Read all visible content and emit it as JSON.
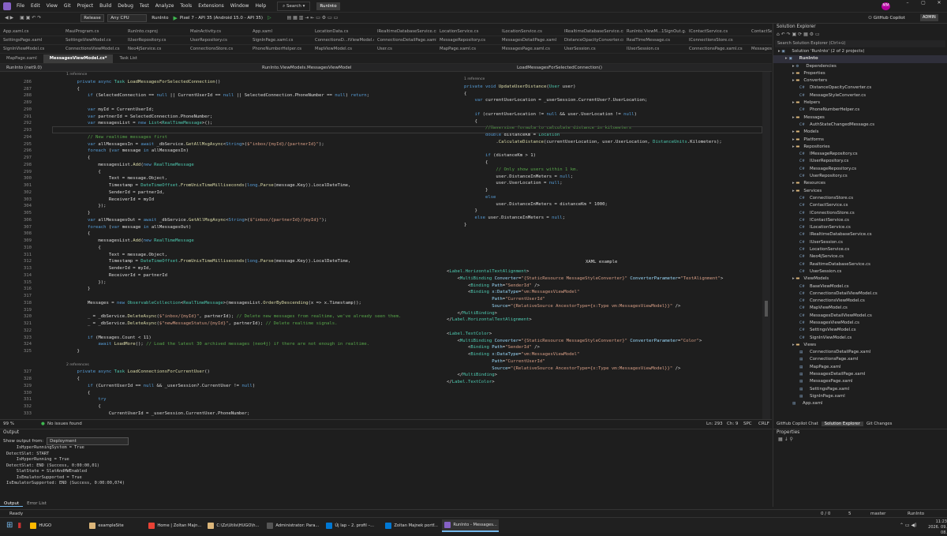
{
  "menu": [
    "File",
    "Edit",
    "View",
    "Git",
    "Project",
    "Build",
    "Debug",
    "Test",
    "Analyze",
    "Tools",
    "Extensions",
    "Window",
    "Help"
  ],
  "search_label": "Search",
  "app_badge": "RunInto",
  "user_initials": "MM",
  "window_controls": [
    "–",
    "▢",
    "✕"
  ],
  "toolbar": {
    "config": "Release",
    "platform": "Any CPU",
    "startup": "RunInto",
    "device": "Pixel 7 - API 35 (Android 15.0 - API 35)",
    "copilot": "GitHub Copilot",
    "admin": "ADMIN"
  },
  "tabs_row1": [
    "App.xaml.cs",
    "MauiProgram.cs",
    "RunInto.csproj",
    "MainActivity.cs",
    "App.xaml",
    "LocationData.cs",
    "IRealtimeDatabaseService.cs",
    "LocationService.cs",
    "ILocationService.cs",
    "IRealtimeDatabaseService.cs",
    "RunInto.ViewM...1SignOut.g.cs",
    "IContactService.cs",
    "ContactService.cs"
  ],
  "tabs_row2": [
    "SettingsPage.xaml",
    "SettingsViewModel.cs",
    "IUserRepository.cs",
    "UserRepository.cs",
    "SignInPage.xaml.cs",
    "ConnectionsD...tViewModel.cs",
    "ConnectionsDetailPage.xaml",
    "MessageRepository.cs",
    "MessagesDetailPage.xaml",
    "DistanceOpacityConverter.cs",
    "RealTimeMessage.cs",
    "IConnectionsStore.cs"
  ],
  "tabs_row3": [
    "SignInViewModel.cs",
    "ConnectionsViewModel.cs",
    "Neo4jService.cs",
    "ConnectionsStore.cs",
    "PhoneNumberHelper.cs",
    "MapViewModel.cs",
    "User.cs",
    "MapPage.xaml.cs",
    "MessagesPage.xaml.cs",
    "UserSession.cs",
    "IUserSession.cs",
    "ConnectionsPage.xaml.cs",
    "MessagesPage.xaml"
  ],
  "editor_tabs": [
    "MapPage.xaml",
    "MessagesViewModel.cs*",
    "Task List"
  ],
  "navbar": {
    "project": "RunInto (net9.0)",
    "class": "RunInto.ViewModels.MessagesViewModel",
    "member": "LoadMessagesForSelectedConnection()"
  },
  "code": {
    "left_lines": [
      [
        "",
        "ref",
        "1 reference"
      ],
      [
        "286",
        "    ",
        "<span class='kw'>private async</span> <span class='ty'>Task</span> <span class='mt'>LoadMessagesForSelectedConnection</span>()"
      ],
      [
        "287",
        "    ",
        "{"
      ],
      [
        "288",
        "        ",
        "<span class='kw'>if</span> (SelectedConnection == <span class='kw'>null</span> || CurrentUserId == <span class='kw'>null</span> || SelectedConnection.PhoneNumber == <span class='kw'>null</span>) <span class='kw'>return</span>;"
      ],
      [
        "289",
        "",
        ""
      ],
      [
        "290",
        "        ",
        "<span class='kw'>var</span> myId = CurrentUserId;"
      ],
      [
        "291",
        "        ",
        "<span class='kw'>var</span> partnerId = SelectedConnection.PhoneNumber;"
      ],
      [
        "292",
        "        ",
        "<span class='kw'>var</span> messagesList = <span class='kw'>new</span> <span class='ty'>List</span>&lt;<span class='ty'>RealTimeMessage</span>&gt;();"
      ],
      [
        "293",
        "",
        ""
      ],
      [
        "294",
        "        ",
        "<span class='cm'>// New realtime messages first</span>"
      ],
      [
        "295",
        "        ",
        "<span class='kw'>var</span> allMessagesIn = <span class='kw'>await</span> _dbService.<span class='mt'>GetAllMsgAsync</span>&lt;<span class='kw'>String</span>&gt;(<span class='st'>$\"inbox/{myId}/{partnerId}\"</span>);"
      ],
      [
        "296",
        "        ",
        "<span class='kw'>foreach</span> (<span class='kw'>var</span> message <span class='kw'>in</span> allMessagesIn)"
      ],
      [
        "297",
        "        ",
        "{"
      ],
      [
        "298",
        "            ",
        "messagesList.<span class='mt'>Add</span>(<span class='kw'>new</span> <span class='ty'>RealTimeMessage</span>"
      ],
      [
        "299",
        "            ",
        "{"
      ],
      [
        "300",
        "                ",
        "Text = message.Object,"
      ],
      [
        "301",
        "                ",
        "Timestamp = <span class='ty'>DateTimeOffset</span>.<span class='mt'>FromUnixTimeMilliseconds</span>(<span class='kw'>long</span>.<span class='mt'>Parse</span>(message.Key)).LocalDateTime,"
      ],
      [
        "302",
        "                ",
        "SenderId = partnerId,"
      ],
      [
        "303",
        "                ",
        "ReceiverId = myId"
      ],
      [
        "304",
        "            ",
        "});"
      ],
      [
        "305",
        "        ",
        "}"
      ],
      [
        "306",
        "        ",
        "<span class='kw'>var</span> allMessagesOut = <span class='kw'>await</span> _dbService.<span class='mt'>GetAllMsgAsync</span>&lt;<span class='kw'>String</span>&gt;(<span class='st'>$\"inbox/{partnerId}/{myId}\"</span>);"
      ],
      [
        "307",
        "        ",
        "<span class='kw'>foreach</span> (<span class='kw'>var</span> message <span class='kw'>in</span> allMessagesOut)"
      ],
      [
        "308",
        "        ",
        "{"
      ],
      [
        "309",
        "            ",
        "messagesList.<span class='mt'>Add</span>(<span class='kw'>new</span> <span class='ty'>RealTimeMessage</span>"
      ],
      [
        "310",
        "            ",
        "{"
      ],
      [
        "311",
        "                ",
        "Text = message.Object,"
      ],
      [
        "312",
        "                ",
        "Timestamp = <span class='ty'>DateTimeOffset</span>.<span class='mt'>FromUnixTimeMilliseconds</span>(<span class='kw'>long</span>.<span class='mt'>Parse</span>(message.Key)).LocalDateTime,"
      ],
      [
        "313",
        "                ",
        "SenderId = myId,"
      ],
      [
        "314",
        "                ",
        "ReceiverId = partnerId"
      ],
      [
        "315",
        "            ",
        "});"
      ],
      [
        "316",
        "        ",
        "}"
      ],
      [
        "317",
        "",
        ""
      ],
      [
        "318",
        "        ",
        "Messages = <span class='kw'>new</span> <span class='ty'>ObservableCollection</span>&lt;<span class='ty'>RealTimeMessage</span>&gt;(messagesList.<span class='mt'>OrderByDescending</span>(x =&gt; x.Timestamp));"
      ],
      [
        "319",
        "",
        ""
      ],
      [
        "320",
        "        ",
        "_ = _dbService.<span class='mt'>DeleteAsync</span>(<span class='st'>$\"inbox/{myId}\"</span>, partnerId); <span class='cm'>// Delete new messages from realtime, we've already seen them.</span>"
      ],
      [
        "321",
        "        ",
        "_ = _dbService.<span class='mt'>DeleteAsync</span>(<span class='st'>$\"newMessageStatus/{myId}\"</span>, partnerId); <span class='cm'>// Delete realtime signals.</span>"
      ],
      [
        "322",
        "",
        ""
      ],
      [
        "323",
        "        ",
        "<span class='kw'>if</span> (Messages.Count &lt; 11)"
      ],
      [
        "324",
        "            ",
        "<span class='kw'>await</span> <span class='mt'>LoadMore</span>(); <span class='cm'>// Load the latest 30 archived messages (neo4j) if there are not enough in realtime.</span>"
      ],
      [
        "325",
        "    ",
        "}"
      ],
      [
        "",
        "",
        ""
      ],
      [
        "",
        "ref",
        "2 references"
      ],
      [
        "327",
        "    ",
        "<span class='kw'>private async</span> <span class='ty'>Task</span> <span class='mt'>LoadConnectionsForCurrentUser</span>()"
      ],
      [
        "328",
        "    ",
        "{"
      ],
      [
        "329",
        "        ",
        "<span class='kw'>if</span> (CurrentUserId == <span class='kw'>null</span> &amp;&amp; _userSession?.CurrentUser != <span class='kw'>null</span>)"
      ],
      [
        "330",
        "        ",
        "{"
      ],
      [
        "331",
        "            ",
        "<span class='kw'>try</span>"
      ],
      [
        "332",
        "            ",
        "{"
      ],
      [
        "333",
        "                ",
        "CurrentUserId = _userSession.CurrentUser.PhoneNumber;"
      ]
    ],
    "right_lines": [
      [
        "ref",
        "1 reference"
      ],
      [
        "",
        "<span class='kw'>private void</span> <span class='mt'>UpdateUserDistance</span>(<span class='ty'>User</span> user)"
      ],
      [
        "",
        "{"
      ],
      [
        "    ",
        "<span class='kw'>var</span> currentUserLocation = _userSession.CurrentUser?.UserLocation;"
      ],
      [
        "",
        ""
      ],
      [
        "    ",
        "<span class='kw'>if</span> (currentUserLocation != <span class='kw'>null</span> &amp;&amp; user.UserLocation != <span class='kw'>null</span>)"
      ],
      [
        "    ",
        "{"
      ],
      [
        "        ",
        "<span class='cm'>//Haversine formula to calculate distance in kilometers</span>"
      ],
      [
        "        ",
        "<span class='kw'>double</span> distanceKm = <span class='ty'>Location</span>"
      ],
      [
        "            ",
        ".<span class='mt'>CalculateDistance</span>(currentUserLocation, user.UserLocation, <span class='ty'>DistanceUnits</span>.Kilometers);"
      ],
      [
        "",
        ""
      ],
      [
        "        ",
        "<span class='kw'>if</span> (distanceKm &gt; 1)"
      ],
      [
        "        ",
        "{"
      ],
      [
        "            ",
        "<span class='cm'>// Only show users within 1 km.</span>"
      ],
      [
        "            ",
        "user.DistanceInMeters = <span class='kw'>null</span>;"
      ],
      [
        "            ",
        "user.UserLocation = <span class='kw'>null</span>;"
      ],
      [
        "        ",
        "}"
      ],
      [
        "        ",
        "<span class='kw'>else</span>"
      ],
      [
        "            ",
        "user.DistanceInMeters = distanceKm * 1000;"
      ],
      [
        "    ",
        "}"
      ],
      [
        "    ",
        "<span class='kw'>else</span> user.DistanceInMeters = <span class='kw'>null</span>;"
      ],
      [
        "",
        "}"
      ]
    ],
    "xaml_title": "XAML example",
    "xaml_lines": [
      "&lt;<span class='ty'>Label.HorizontalTextAlignment</span>&gt;",
      "    &lt;<span class='ty'>MultiBinding</span> <span class='va'>Converter</span>=<span class='st'>\"{StaticResource MessageStyleConverter}\"</span> <span class='va'>ConverterParameter</span>=<span class='st'>\"TextAlignment\"</span>&gt;",
      "        &lt;<span class='ty'>Binding</span> <span class='va'>Path</span>=<span class='st'>\"SenderId\"</span> /&gt;",
      "        &lt;<span class='ty'>Binding</span> <span class='va'>x:DataType</span>=<span class='st'>\"vm:MessagesViewModel\"</span>",
      "                 <span class='va'>Path</span>=<span class='st'>\"CurrentUserId\"</span>",
      "                 <span class='va'>Source</span>=<span class='st'>\"{RelativeSource AncestorType={x:Type vm:MessagesViewModel}}\"</span> /&gt;",
      "    &lt;/<span class='ty'>MultiBinding</span>&gt;",
      "&lt;/<span class='ty'>Label.HorizontalTextAlignment</span>&gt;",
      "",
      "&lt;<span class='ty'>Label.TextColor</span>&gt;",
      "    &lt;<span class='ty'>MultiBinding</span> <span class='va'>Converter</span>=<span class='st'>\"{StaticResource MessageStyleConverter}\"</span> <span class='va'>ConverterParameter</span>=<span class='st'>\"Color\"</span>&gt;",
      "        &lt;<span class='ty'>Binding</span> <span class='va'>Path</span>=<span class='st'>\"SenderId\"</span> /&gt;",
      "        &lt;<span class='ty'>Binding</span> <span class='va'>x:DataType</span>=<span class='st'>\"vm:MessagesViewModel\"</span>",
      "                 <span class='va'>Path</span>=<span class='st'>\"CurrentUserId\"</span>",
      "                 <span class='va'>Source</span>=<span class='st'>\"{RelativeSource AncestorType={x:Type vm:MessagesViewModel}}\"</span> /&gt;",
      "    &lt;/<span class='ty'>MultiBinding</span>&gt;",
      "&lt;/<span class='ty'>Label.TextColor</span>&gt;"
    ]
  },
  "editor_status": {
    "zoom": "99 %",
    "issues": "No issues found",
    "ln": "Ln: 293",
    "ch": "Ch: 9",
    "spc": "SPC",
    "crlf": "CRLF"
  },
  "output": {
    "title": "Output",
    "from_label": "Show output from:",
    "source": "Deployment",
    "lines": [
      "    IsHyperRunningSystem = True",
      "DetectSlat: START",
      "    IsHyperRunning = True",
      "DetectSlat: END (Success, 0:00:00,01)",
      "    SlatState = SlatAndHWEnabled",
      "    IsEmulatorSupported = True",
      "IsEmulatorSupported: END (Success, 0:00:00,074)"
    ],
    "tabs": [
      "Output",
      "Error List"
    ]
  },
  "solution_explorer": {
    "title": "Solution Explorer",
    "search_placeholder": "Search Solution Explorer (Ctrl+ü)",
    "items": [
      {
        "t": "Solution 'RunInto' (2 of 2 projects)",
        "d": 0,
        "k": "sln"
      },
      {
        "t": "RunInto",
        "d": 1,
        "k": "proj"
      },
      {
        "t": "Dependencies",
        "d": 2,
        "k": "dep"
      },
      {
        "t": "Properties",
        "d": 2,
        "k": "folder"
      },
      {
        "t": "Converters",
        "d": 2,
        "k": "folder"
      },
      {
        "t": "DistanceOpacityConverter.cs",
        "d": 3,
        "k": "cs"
      },
      {
        "t": "MessageStyleConverter.cs",
        "d": 3,
        "k": "cs"
      },
      {
        "t": "Helpers",
        "d": 2,
        "k": "folder"
      },
      {
        "t": "PhoneNumberHelper.cs",
        "d": 3,
        "k": "cs"
      },
      {
        "t": "Messages",
        "d": 2,
        "k": "folder"
      },
      {
        "t": "AuthStateChangedMessage.cs",
        "d": 3,
        "k": "cs"
      },
      {
        "t": "Models",
        "d": 2,
        "k": "folder"
      },
      {
        "t": "Platforms",
        "d": 2,
        "k": "folder"
      },
      {
        "t": "Repositories",
        "d": 2,
        "k": "folder"
      },
      {
        "t": "IMessageRepository.cs",
        "d": 3,
        "k": "cs"
      },
      {
        "t": "IUserRepository.cs",
        "d": 3,
        "k": "cs"
      },
      {
        "t": "MessageRepository.cs",
        "d": 3,
        "k": "cs"
      },
      {
        "t": "UserRepository.cs",
        "d": 3,
        "k": "cs"
      },
      {
        "t": "Resources",
        "d": 2,
        "k": "folder"
      },
      {
        "t": "Services",
        "d": 2,
        "k": "folder"
      },
      {
        "t": "ConnectionsStore.cs",
        "d": 3,
        "k": "cs"
      },
      {
        "t": "ContactService.cs",
        "d": 3,
        "k": "cs"
      },
      {
        "t": "IConnectionsStore.cs",
        "d": 3,
        "k": "cs"
      },
      {
        "t": "IContactService.cs",
        "d": 3,
        "k": "cs"
      },
      {
        "t": "ILocationService.cs",
        "d": 3,
        "k": "cs"
      },
      {
        "t": "IRealtimeDatabaseService.cs",
        "d": 3,
        "k": "cs"
      },
      {
        "t": "IUserSession.cs",
        "d": 3,
        "k": "cs"
      },
      {
        "t": "LocationService.cs",
        "d": 3,
        "k": "cs"
      },
      {
        "t": "Neo4jService.cs",
        "d": 3,
        "k": "cs"
      },
      {
        "t": "RealtimeDatabaseService.cs",
        "d": 3,
        "k": "cs"
      },
      {
        "t": "UserSession.cs",
        "d": 3,
        "k": "cs"
      },
      {
        "t": "ViewModels",
        "d": 2,
        "k": "folder"
      },
      {
        "t": "BaseViewModel.cs",
        "d": 3,
        "k": "cs"
      },
      {
        "t": "ConnectionsDetailViewModel.cs",
        "d": 3,
        "k": "cs"
      },
      {
        "t": "ConnectionsViewModel.cs",
        "d": 3,
        "k": "cs"
      },
      {
        "t": "MapViewModel.cs",
        "d": 3,
        "k": "cs"
      },
      {
        "t": "MessagesDetailViewModel.cs",
        "d": 3,
        "k": "cs"
      },
      {
        "t": "MessagesViewModel.cs",
        "d": 3,
        "k": "cs"
      },
      {
        "t": "SettingsViewModel.cs",
        "d": 3,
        "k": "cs"
      },
      {
        "t": "SignInViewModel.cs",
        "d": 3,
        "k": "cs"
      },
      {
        "t": "Views",
        "d": 2,
        "k": "folder"
      },
      {
        "t": "ConnectionsDetailPage.xaml",
        "d": 3,
        "k": "xaml"
      },
      {
        "t": "ConnectionsPage.xaml",
        "d": 3,
        "k": "xaml"
      },
      {
        "t": "MapPage.xaml",
        "d": 3,
        "k": "xaml"
      },
      {
        "t": "MessagesDetailPage.xaml",
        "d": 3,
        "k": "xaml"
      },
      {
        "t": "MessagesPage.xaml",
        "d": 3,
        "k": "xaml"
      },
      {
        "t": "SettingsPage.xaml",
        "d": 3,
        "k": "xaml"
      },
      {
        "t": "SignInPage.xaml",
        "d": 3,
        "k": "xaml"
      },
      {
        "t": "App.xaml",
        "d": 2,
        "k": "xaml"
      }
    ],
    "bottom_tabs": [
      "GitHub Copilot Chat",
      "Solution Explorer",
      "Git Changes"
    ]
  },
  "properties": {
    "title": "Properties"
  },
  "statusbar": {
    "ready": "Ready",
    "updown": "0 / 0",
    "pencil": "5",
    "branch": "master",
    "repo": "RunInto"
  },
  "taskbar": {
    "items": [
      "HUGO",
      "exampleSite",
      "Home | Zoltan Majn...",
      "C:\\Zz\\Utils\\HUGO\\h...",
      "Administrator: Para...",
      "Új lap – 2. profil –...",
      "Zoltan Majnek portf...",
      "RunInto - Messages..."
    ],
    "time": "11:23",
    "date": "2026. 09. 08."
  },
  "colors": {
    "accent": "#68217a",
    "vs_purple": "#8661c5",
    "active_tab": "#3c3c3c"
  }
}
